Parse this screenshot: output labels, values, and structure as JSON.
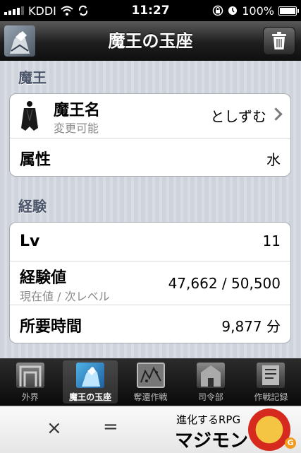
{
  "status_bar": {
    "carrier": "KDDI",
    "time": "11:27",
    "battery": "100%"
  },
  "nav": {
    "title": "魔王の玉座",
    "trash_icon": "trash-icon",
    "avatar_icon": "maou-avatar-icon"
  },
  "sections": [
    {
      "header": "魔王",
      "rows": [
        {
          "label": "魔王名",
          "sublabel": "変更可能",
          "value": "としずむ",
          "disclosure": true
        },
        {
          "label": "属性",
          "value": "水"
        }
      ]
    },
    {
      "header": "経験",
      "rows": [
        {
          "label": "Lv",
          "value": "11"
        },
        {
          "label": "経験値",
          "sublabel": "現在値 / 次レベル",
          "value": "47,662 / 50,500"
        },
        {
          "label": "所要時間",
          "value": "9,877 分"
        }
      ]
    }
  ],
  "tabbar": {
    "tabs": [
      {
        "label": "外界",
        "icon": "gate-icon",
        "active": false
      },
      {
        "label": "魔王の玉座",
        "icon": "throne-icon",
        "active": true
      },
      {
        "label": "奪還作戦",
        "icon": "map-icon",
        "active": false
      },
      {
        "label": "司令部",
        "icon": "headquarters-icon",
        "active": false
      },
      {
        "label": "作戦記録",
        "icon": "record-icon",
        "active": false
      }
    ]
  },
  "ad": {
    "symbol_x": "×",
    "symbol_eq": "=",
    "tagline": "進化するRPG",
    "game_name": "マジモン",
    "badge": "G"
  }
}
